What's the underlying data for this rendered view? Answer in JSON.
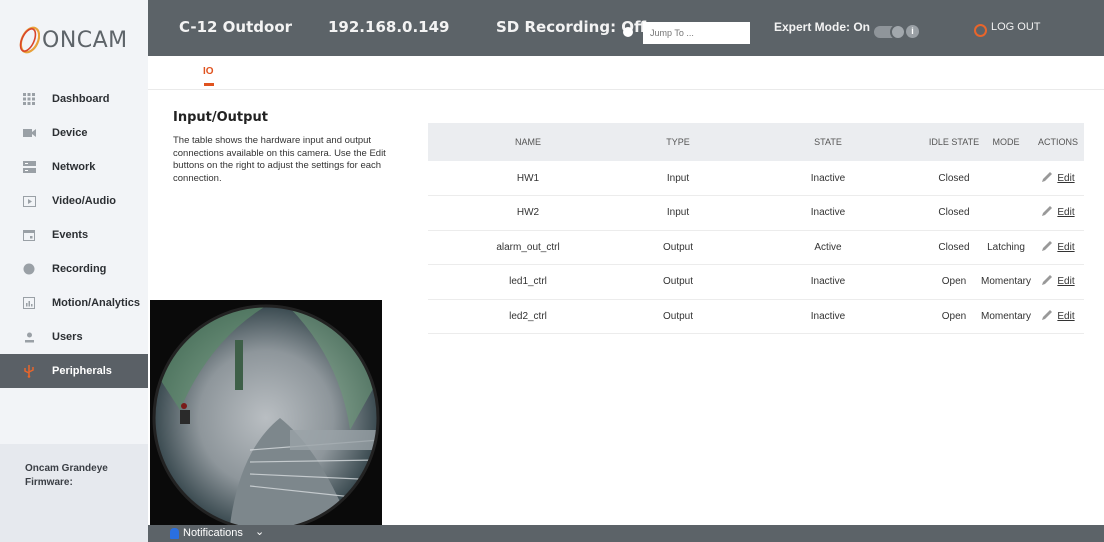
{
  "brand": {
    "name": "ONCAM"
  },
  "header": {
    "device_name": "C-12 Outdoor",
    "device_ip": "192.168.0.149",
    "sd_recording": "SD Recording: Off",
    "jump_placeholder": "Jump To ...",
    "expert_mode": "Expert Mode: On",
    "logout": "LOG OUT",
    "accent": "#e8652b"
  },
  "sidebar": {
    "items": [
      {
        "label": "Dashboard",
        "icon": "grid-icon"
      },
      {
        "label": "Device",
        "icon": "camera-icon"
      },
      {
        "label": "Network",
        "icon": "server-icon"
      },
      {
        "label": "Video/Audio",
        "icon": "play-icon"
      },
      {
        "label": "Events",
        "icon": "calendar-icon"
      },
      {
        "label": "Recording",
        "icon": "record-icon"
      },
      {
        "label": "Motion/Analytics",
        "icon": "chart-icon"
      },
      {
        "label": "Users",
        "icon": "user-icon"
      },
      {
        "label": "Peripherals",
        "icon": "usb-icon",
        "active": true
      }
    ],
    "firmware_line1": "Oncam Grandeye",
    "firmware_line2": "Firmware:"
  },
  "tabs": {
    "io": "IO"
  },
  "section": {
    "title": "Input/Output",
    "description": "The table shows the hardware input and output connections available on this camera. Use the Edit buttons on the right to adjust the settings for each connection."
  },
  "table": {
    "headers": {
      "name": "NAME",
      "type": "TYPE",
      "state": "STATE",
      "idle": "IDLE STATE",
      "mode": "MODE",
      "actions": "ACTIONS"
    },
    "rows": [
      {
        "name": "HW1",
        "type": "Input",
        "state": "Inactive",
        "idle": "Closed",
        "mode": "",
        "action": "Edit"
      },
      {
        "name": "HW2",
        "type": "Input",
        "state": "Inactive",
        "idle": "Closed",
        "mode": "",
        "action": "Edit"
      },
      {
        "name": "alarm_out_ctrl",
        "type": "Output",
        "state": "Active",
        "idle": "Closed",
        "mode": "Latching",
        "action": "Edit"
      },
      {
        "name": "led1_ctrl",
        "type": "Output",
        "state": "Inactive",
        "idle": "Open",
        "mode": "Momentary",
        "action": "Edit"
      },
      {
        "name": "led2_ctrl",
        "type": "Output",
        "state": "Inactive",
        "idle": "Open",
        "mode": "Momentary",
        "action": "Edit"
      }
    ]
  },
  "notifications": {
    "label": "Notifications"
  }
}
